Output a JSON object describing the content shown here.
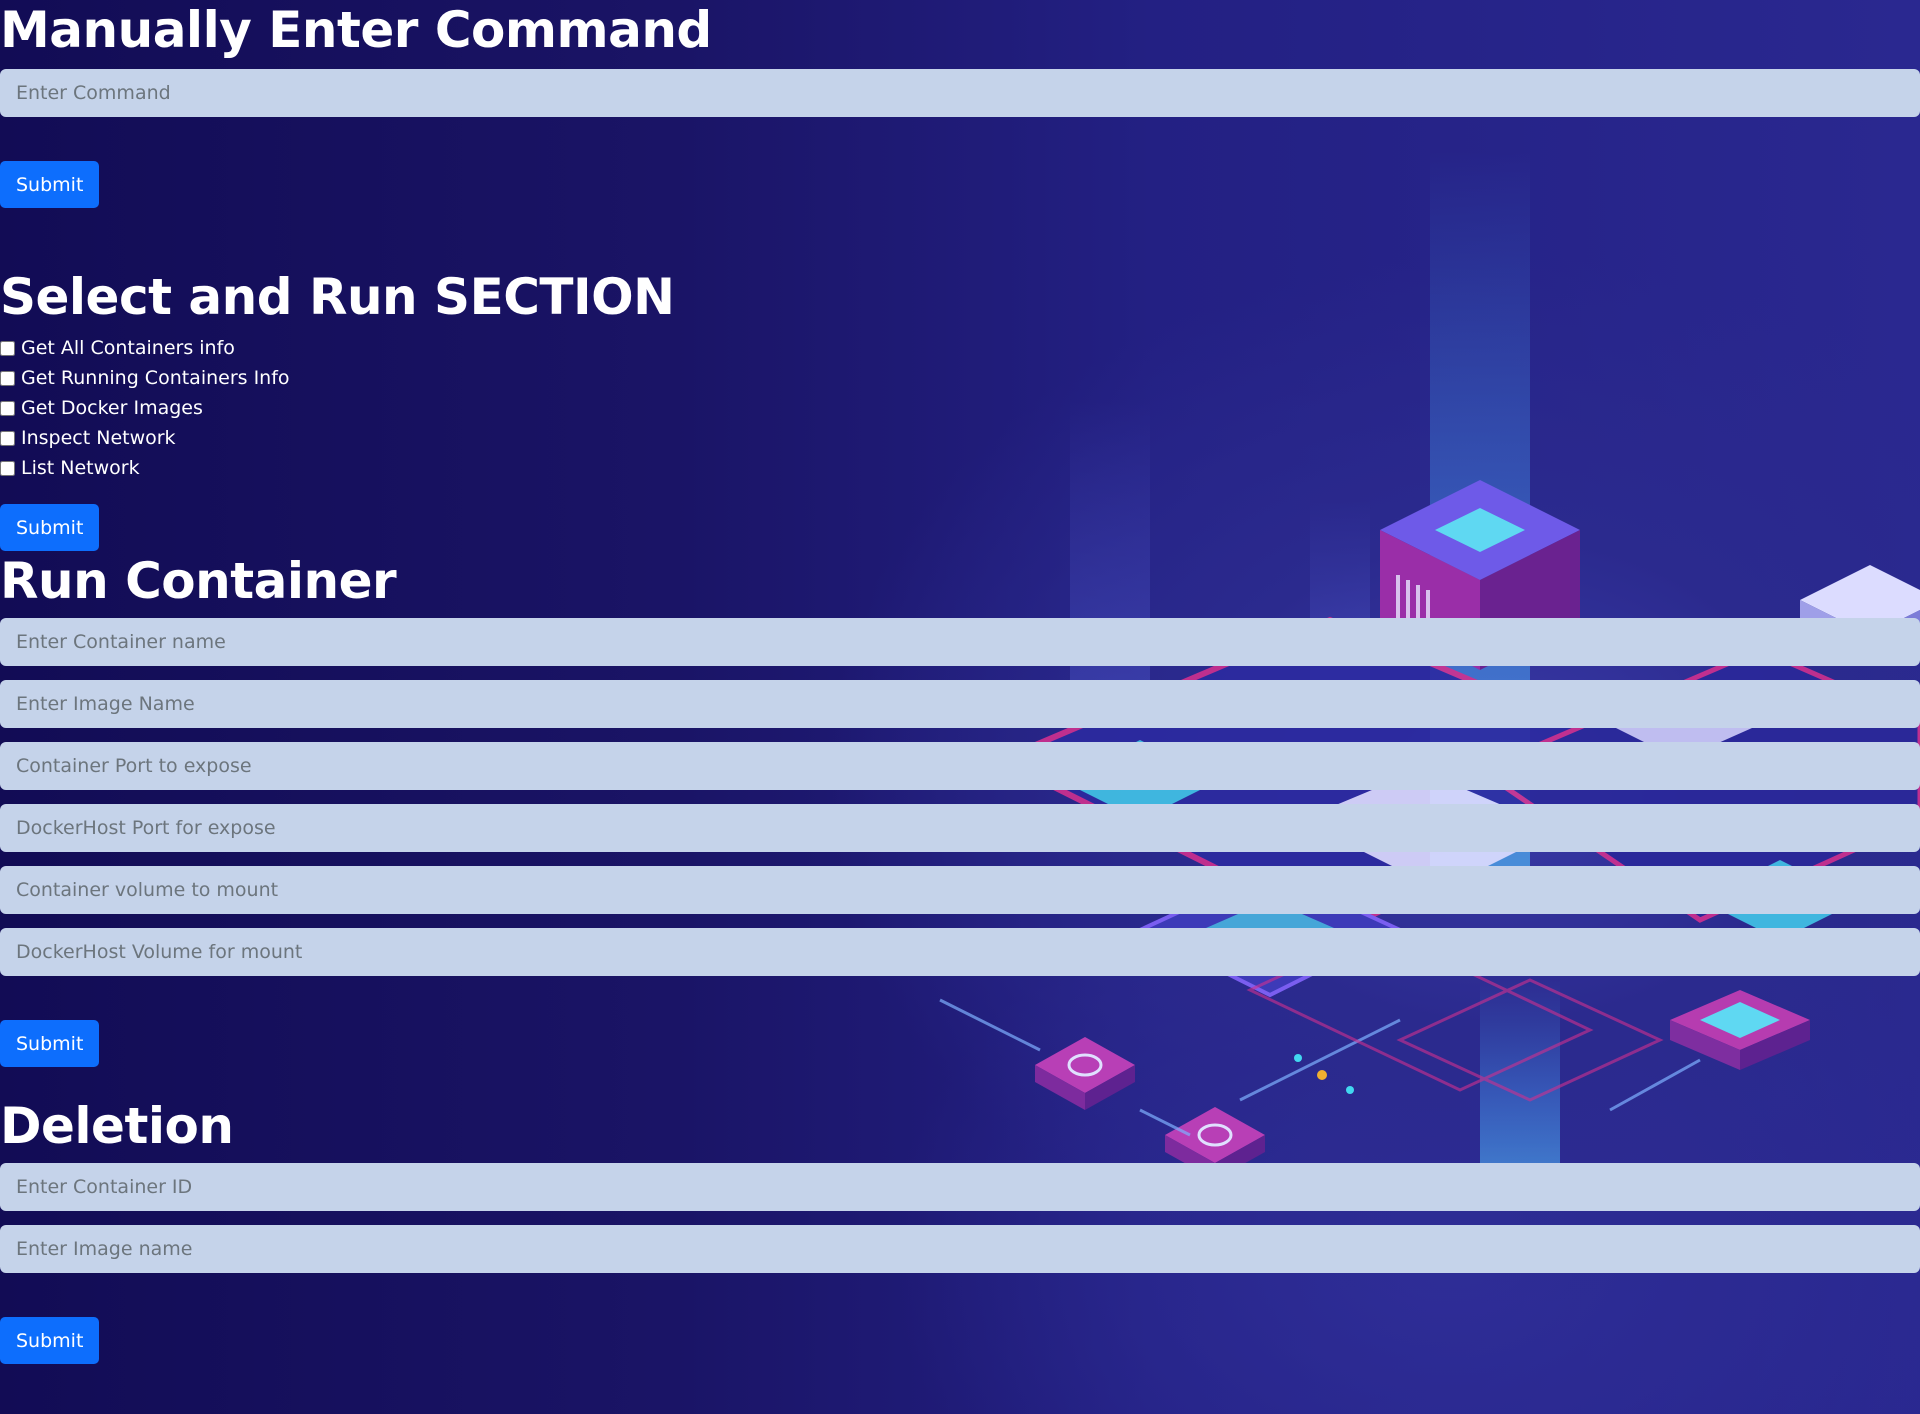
{
  "manual": {
    "heading": "Manually Enter Command",
    "command_placeholder": "Enter Command",
    "submit_label": "Submit"
  },
  "select_run": {
    "heading": "Select and Run SECTION",
    "options": [
      {
        "label": "Get All Containers info",
        "checked": false
      },
      {
        "label": "Get Running Containers Info",
        "checked": false
      },
      {
        "label": "Get Docker Images",
        "checked": false
      },
      {
        "label": "Inspect Network",
        "checked": false
      },
      {
        "label": "List Network",
        "checked": false
      }
    ],
    "submit_label": "Submit"
  },
  "run_container": {
    "heading": "Run Container",
    "fields": [
      {
        "placeholder": "Enter Container name"
      },
      {
        "placeholder": "Enter Image Name"
      },
      {
        "placeholder": "Container Port to expose"
      },
      {
        "placeholder": "DockerHost Port for expose"
      },
      {
        "placeholder": "Container volume to mount"
      },
      {
        "placeholder": "DockerHost Volume for mount"
      }
    ],
    "submit_label": "Submit"
  },
  "deletion": {
    "heading": "Deletion",
    "fields": [
      {
        "placeholder": "Enter Container ID"
      },
      {
        "placeholder": "Enter Image name"
      }
    ],
    "submit_label": "Submit"
  },
  "colors": {
    "background": "#1a1466",
    "input_background": "#c5d3ea",
    "button": "#0d6efd",
    "heading_text": "#ffffff"
  }
}
